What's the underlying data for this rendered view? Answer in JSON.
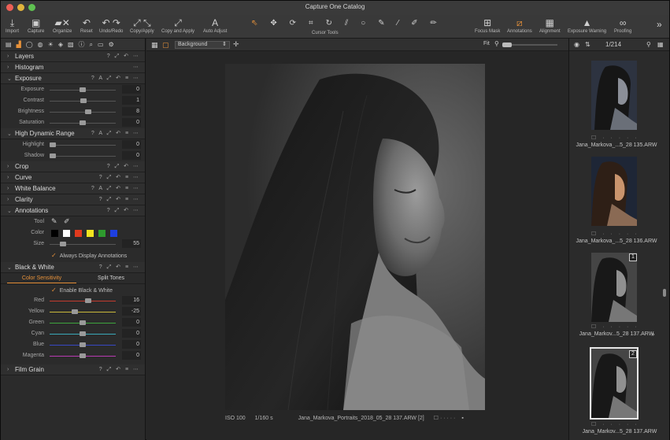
{
  "window": {
    "title": "Capture One Catalog"
  },
  "toolbar": {
    "items": [
      {
        "label": "Import",
        "icon": "import-icon"
      },
      {
        "label": "Capture",
        "icon": "camera-icon"
      },
      {
        "label": "Organize",
        "icon": "organize-icon"
      },
      {
        "label": "Reset",
        "icon": "reset-icon"
      },
      {
        "label": "Undo/Redo",
        "icon": "undo-icon"
      },
      {
        "label": "Copy/Apply",
        "icon": "copy-apply-icon"
      },
      {
        "label": "Copy and Apply",
        "icon": "copy-and-apply-icon"
      },
      {
        "label": "Auto Adjust",
        "icon": "auto-adjust-icon"
      }
    ],
    "cursor_tools_label": "Cursor Tools",
    "right_items": [
      {
        "label": "Focus Mask",
        "icon": "focus-mask-icon"
      },
      {
        "label": "Annotations",
        "icon": "annotations-icon"
      },
      {
        "label": "Alignment",
        "icon": "grid-icon"
      },
      {
        "label": "Exposure Warning",
        "icon": "warning-icon"
      },
      {
        "label": "Proofing",
        "icon": "glasses-icon"
      }
    ]
  },
  "left_panel": {
    "sections": {
      "layers": "Layers",
      "histogram": "Histogram",
      "exposure": "Exposure",
      "hdr": "High Dynamic Range",
      "crop": "Crop",
      "curve": "Curve",
      "white_balance": "White Balance",
      "clarity": "Clarity",
      "annotations": "Annotations",
      "black_white": "Black & White",
      "film_grain": "Film Grain"
    },
    "exposure_sliders": [
      {
        "label": "Exposure",
        "value": "0",
        "pos": 0.5
      },
      {
        "label": "Contrast",
        "value": "1",
        "pos": 0.51
      },
      {
        "label": "Brightness",
        "value": "8",
        "pos": 0.58
      },
      {
        "label": "Saturation",
        "value": "0",
        "pos": 0.5
      }
    ],
    "hdr_sliders": [
      {
        "label": "Highlight",
        "value": "0",
        "pos": 0.05
      },
      {
        "label": "Shadow",
        "value": "0",
        "pos": 0.05
      }
    ],
    "annotations": {
      "tool_label": "Tool",
      "color_label": "Color",
      "size_label": "Size",
      "size_value": "55",
      "size_pos": 0.2,
      "always_display": "Always Display Annotations",
      "colors": [
        "#000000",
        "#ffffff",
        "#e03a1e",
        "#f2e41f",
        "#2e9b2e",
        "#1e3fe0"
      ]
    },
    "bw": {
      "tab_color": "Color Sensitivity",
      "tab_split": "Split Tones",
      "enable_label": "Enable Black & White",
      "sliders": [
        {
          "label": "Red",
          "value": "16",
          "pos": 0.58,
          "color": "#c23b2e"
        },
        {
          "label": "Yellow",
          "value": "-25",
          "pos": 0.38,
          "color": "#c9b83a"
        },
        {
          "label": "Green",
          "value": "0",
          "pos": 0.5,
          "color": "#3ea53e"
        },
        {
          "label": "Cyan",
          "value": "0",
          "pos": 0.5,
          "color": "#3aa9b8"
        },
        {
          "label": "Blue",
          "value": "0",
          "pos": 0.5,
          "color": "#3848c4"
        },
        {
          "label": "Magenta",
          "value": "0",
          "pos": 0.5,
          "color": "#b83ab2"
        }
      ]
    }
  },
  "viewer": {
    "preset": "Background",
    "fit_label": "Fit",
    "iso": "ISO 100",
    "shutter": "1/160 s",
    "filename": "Jana_Markova_Portraits_2018_05_28 137.ARW [2]"
  },
  "browser": {
    "counter": "1/214",
    "thumbs": [
      {
        "file": "Jana_Markova_...5_28 135.ARW",
        "badge": ""
      },
      {
        "file": "Jana_Markova_...5_28 136.ARW",
        "badge": ""
      },
      {
        "file": "Jana_Markov...5_28 137.ARW",
        "badge": "1"
      },
      {
        "file": "Jana_Markov...5_28 137.ARW",
        "badge": "2"
      }
    ]
  }
}
